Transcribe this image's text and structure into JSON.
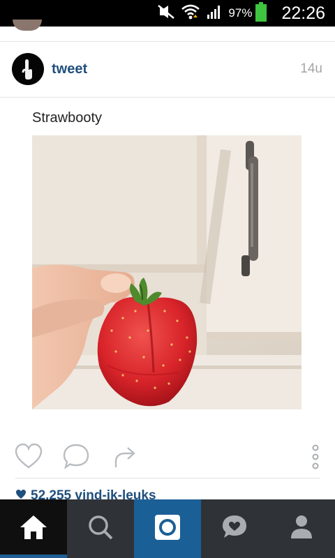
{
  "status_bar": {
    "battery_percent": "97%",
    "time": "22:26",
    "icons": [
      "mute-icon",
      "wifi-icon",
      "signal-icon",
      "battery-icon"
    ]
  },
  "post": {
    "username": "tweet",
    "timestamp": "14u",
    "text": "Strawbooty",
    "likes": "52.255 vind-ik-leuks"
  },
  "actions": [
    "like-heart-icon",
    "comment-bubble-icon",
    "share-arrow-icon",
    "more-options-icon"
  ],
  "nav": [
    "home-icon",
    "search-icon",
    "camera-icon",
    "activity-heart-icon",
    "profile-icon"
  ],
  "colors": {
    "username": "#1f4f7d",
    "nav_background": "#2f3337",
    "nav_active": "#1b5f97"
  }
}
